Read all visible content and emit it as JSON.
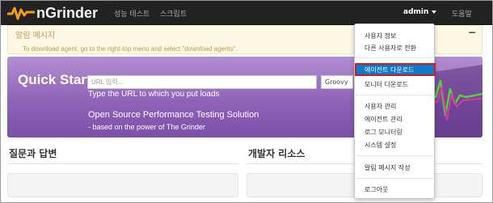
{
  "app": {
    "logo_text": "nGrinder"
  },
  "navbar": {
    "links": [
      "성능 테스트",
      "스크립트"
    ],
    "user": "admin",
    "help": "도움말"
  },
  "notice": {
    "title": "알림 메시지",
    "text": "To download agent, go to the right-top menu and select \"download agents\".",
    "collapse": "−"
  },
  "quick_start": {
    "title": "Quick Start",
    "url_placeholder": "URL 입력...",
    "script_type": "Groovy",
    "hint": "Type the URL to which you put loads",
    "subtitle": "Open Source Performance Testing Solution",
    "tagline": "- based on the power of The Grinder"
  },
  "sections": {
    "qna": "질문과 답변",
    "dev_resources": "개발자 리소스"
  },
  "user_menu": {
    "items": [
      "사용자 정보",
      "다른 사용자로 전환",
      "에이전트 다운로드",
      "모니터 다운로드",
      "사용자 관리",
      "에이전트 관리",
      "로그 모니터링",
      "시스템 설정",
      "알림 메시지 작성",
      "로그아웃"
    ],
    "highlighted_index": 2
  },
  "colors": {
    "navbar": "#222222",
    "hero": "#8f63b8",
    "highlight": "#0a7ac9",
    "highlight_border": "#d21b1b",
    "logo_accent": "#f39c12"
  }
}
